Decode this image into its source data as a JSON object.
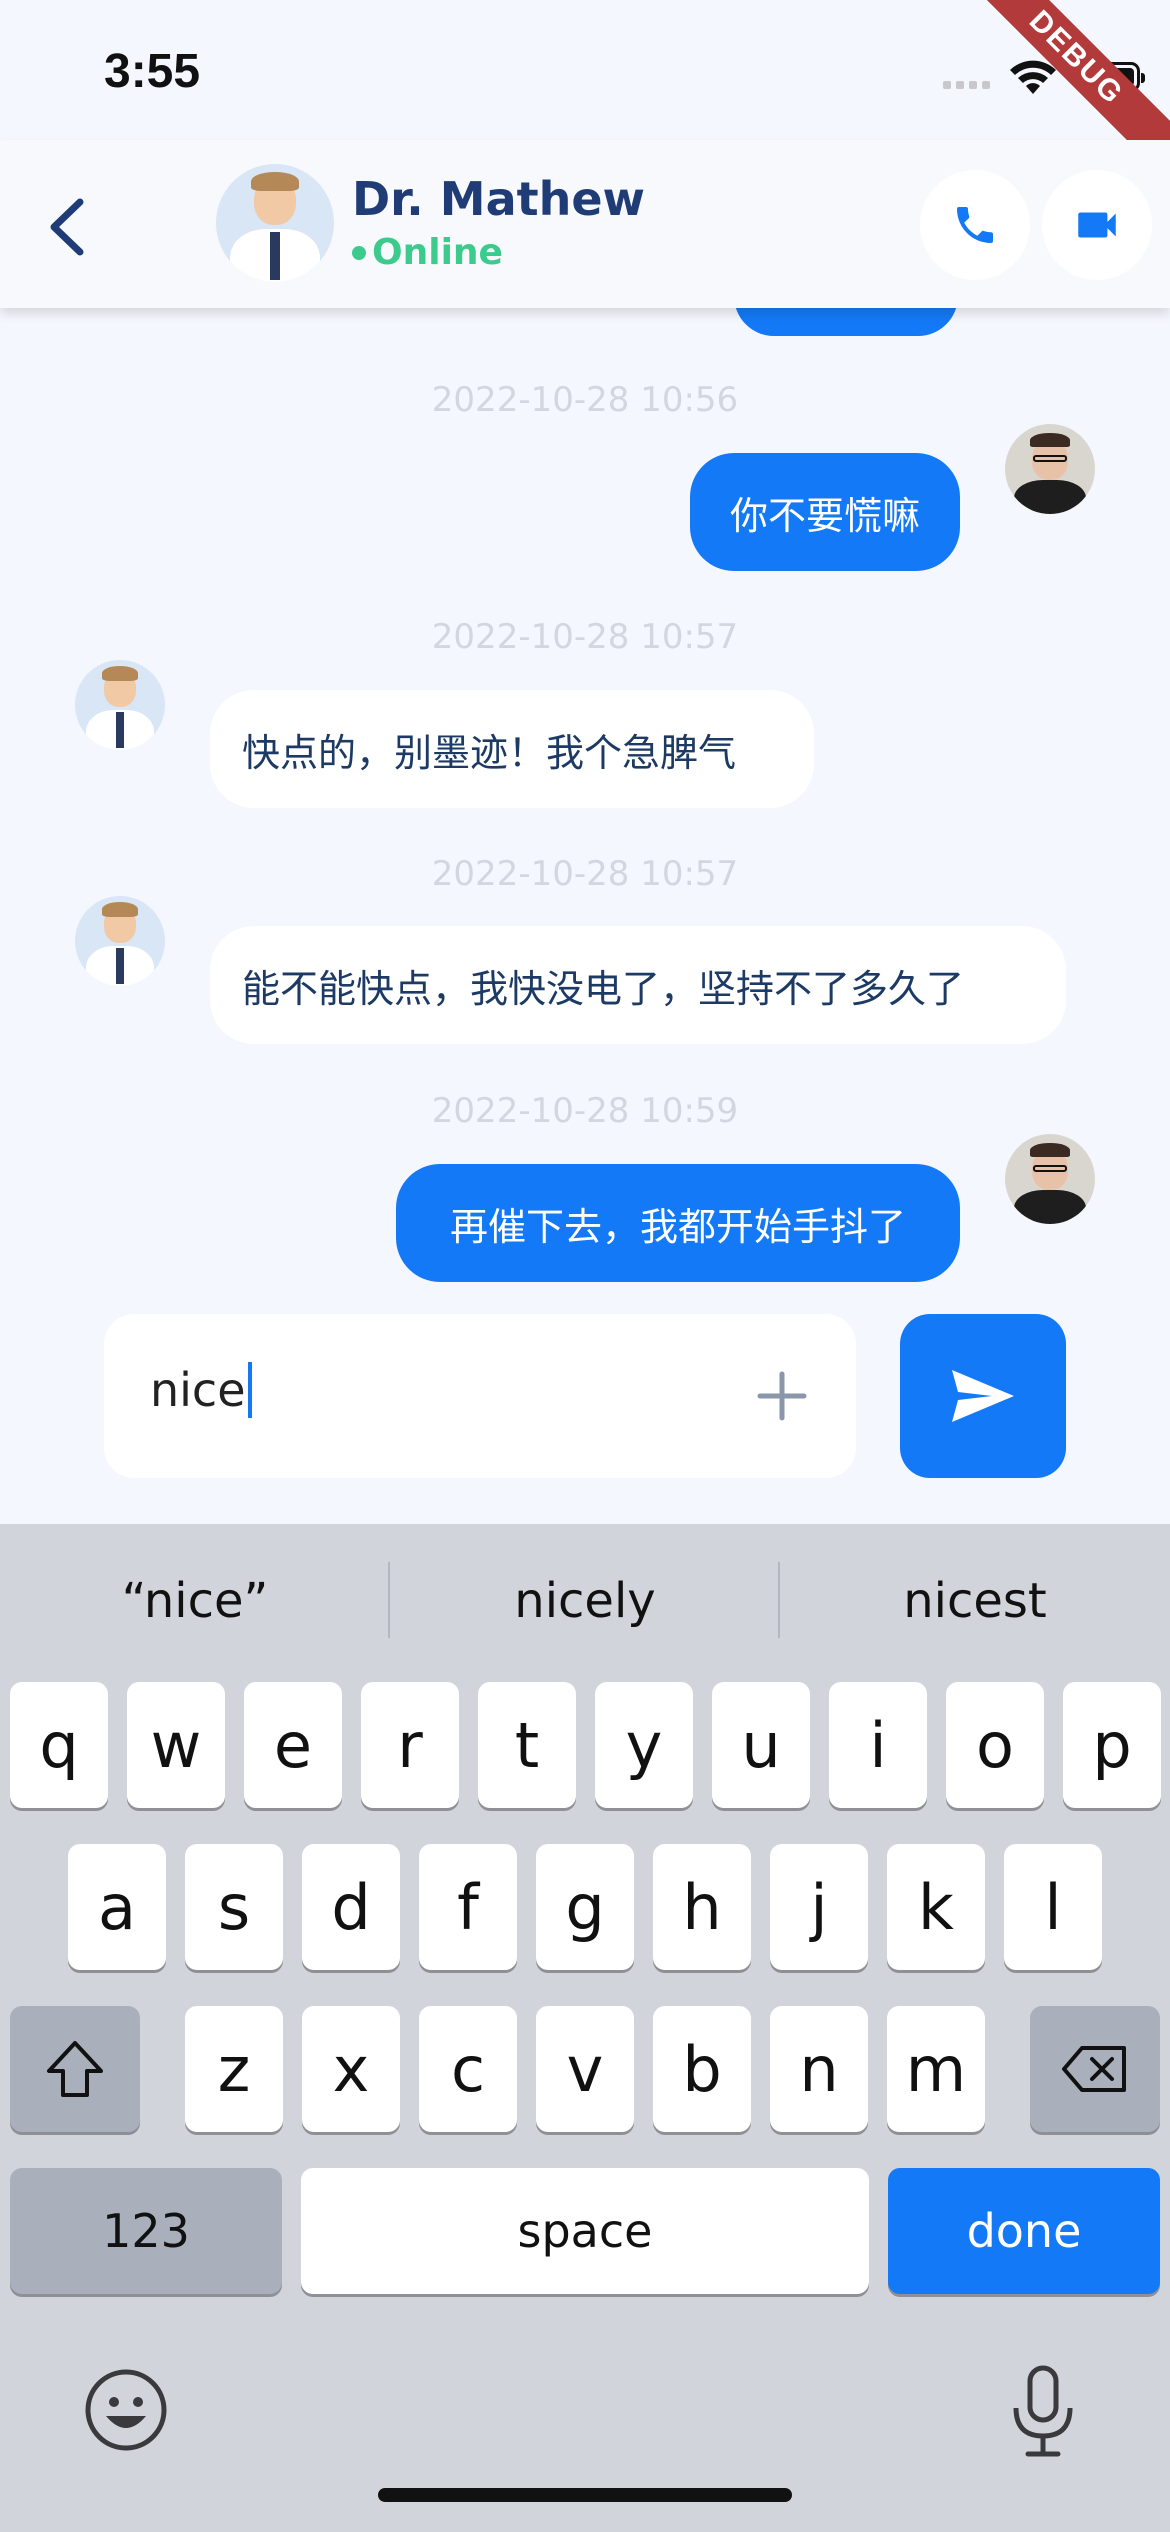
{
  "status_bar": {
    "time": "3:55"
  },
  "debug_banner": "DEBUG",
  "header": {
    "name": "Dr. Mathew",
    "status": "Online"
  },
  "messages": [
    {
      "timestamp": "2022-10-28 10:56",
      "direction": "out",
      "text": "你不要慌嘛"
    },
    {
      "timestamp": "2022-10-28 10:57",
      "direction": "in",
      "text": "快点的，别墨迹！我个急脾气"
    },
    {
      "timestamp": "2022-10-28 10:57",
      "direction": "in",
      "text": "能不能快点，我快没电了，坚持不了多久了"
    },
    {
      "timestamp": "2022-10-28 10:59",
      "direction": "out",
      "text": "再催下去，我都开始手抖了"
    }
  ],
  "composer": {
    "value": "nice"
  },
  "keyboard": {
    "suggestions": [
      "“nice”",
      "nicely",
      "nicest"
    ],
    "row1": [
      "q",
      "w",
      "e",
      "r",
      "t",
      "y",
      "u",
      "i",
      "o",
      "p"
    ],
    "row2": [
      "a",
      "s",
      "d",
      "f",
      "g",
      "h",
      "j",
      "k",
      "l"
    ],
    "row3": [
      "z",
      "x",
      "c",
      "v",
      "b",
      "n",
      "m"
    ],
    "numbers_key": "123",
    "space_key": "space",
    "done_key": "done"
  },
  "colors": {
    "primary": "#1479f6",
    "title": "#1f3c76",
    "online": "#3ccb8c",
    "background": "#f4f7fd",
    "keyboard": "#d1d4db"
  }
}
